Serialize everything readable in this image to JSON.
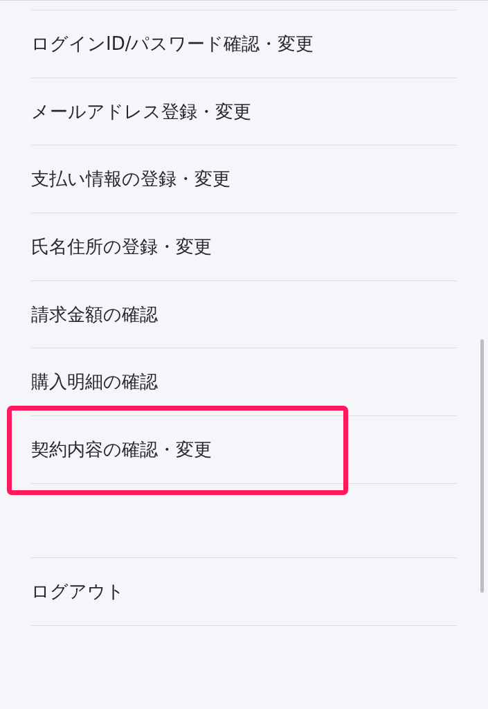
{
  "groups": [
    {
      "items": [
        {
          "label": "ログインID/パスワード確認・変更",
          "highlighted": false
        },
        {
          "label": "メールアドレス登録・変更",
          "highlighted": false
        },
        {
          "label": "支払い情報の登録・変更",
          "highlighted": false
        },
        {
          "label": "氏名住所の登録・変更",
          "highlighted": false
        },
        {
          "label": "請求金額の確認",
          "highlighted": false
        },
        {
          "label": "購入明細の確認",
          "highlighted": false
        },
        {
          "label": "契約内容の確認・変更",
          "highlighted": true
        }
      ]
    },
    {
      "items": [
        {
          "label": "ログアウト",
          "highlighted": false
        }
      ]
    }
  ]
}
